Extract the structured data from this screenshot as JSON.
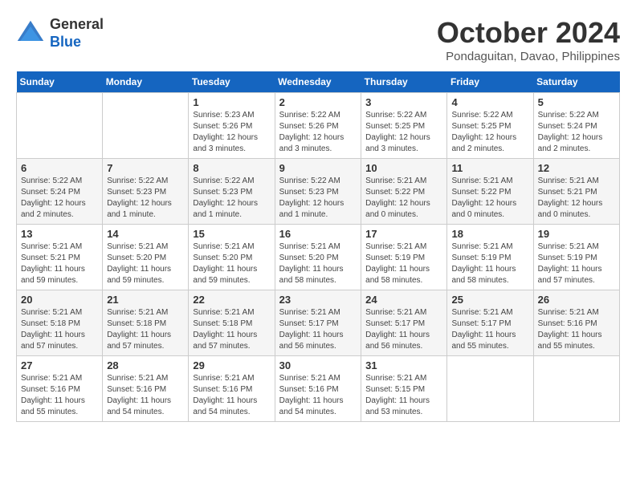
{
  "header": {
    "logo": {
      "general": "General",
      "blue": "Blue"
    },
    "title": "October 2024",
    "subtitle": "Pondaguitan, Davao, Philippines"
  },
  "weekdays": [
    "Sunday",
    "Monday",
    "Tuesday",
    "Wednesday",
    "Thursday",
    "Friday",
    "Saturday"
  ],
  "weeks": [
    [
      {
        "day": null
      },
      {
        "day": null
      },
      {
        "day": 1,
        "sunrise": "5:23 AM",
        "sunset": "5:26 PM",
        "daylight": "12 hours and 3 minutes."
      },
      {
        "day": 2,
        "sunrise": "5:22 AM",
        "sunset": "5:26 PM",
        "daylight": "12 hours and 3 minutes."
      },
      {
        "day": 3,
        "sunrise": "5:22 AM",
        "sunset": "5:25 PM",
        "daylight": "12 hours and 3 minutes."
      },
      {
        "day": 4,
        "sunrise": "5:22 AM",
        "sunset": "5:25 PM",
        "daylight": "12 hours and 2 minutes."
      },
      {
        "day": 5,
        "sunrise": "5:22 AM",
        "sunset": "5:24 PM",
        "daylight": "12 hours and 2 minutes."
      }
    ],
    [
      {
        "day": 6,
        "sunrise": "5:22 AM",
        "sunset": "5:24 PM",
        "daylight": "12 hours and 2 minutes."
      },
      {
        "day": 7,
        "sunrise": "5:22 AM",
        "sunset": "5:23 PM",
        "daylight": "12 hours and 1 minute."
      },
      {
        "day": 8,
        "sunrise": "5:22 AM",
        "sunset": "5:23 PM",
        "daylight": "12 hours and 1 minute."
      },
      {
        "day": 9,
        "sunrise": "5:22 AM",
        "sunset": "5:23 PM",
        "daylight": "12 hours and 1 minute."
      },
      {
        "day": 10,
        "sunrise": "5:21 AM",
        "sunset": "5:22 PM",
        "daylight": "12 hours and 0 minutes."
      },
      {
        "day": 11,
        "sunrise": "5:21 AM",
        "sunset": "5:22 PM",
        "daylight": "12 hours and 0 minutes."
      },
      {
        "day": 12,
        "sunrise": "5:21 AM",
        "sunset": "5:21 PM",
        "daylight": "12 hours and 0 minutes."
      }
    ],
    [
      {
        "day": 13,
        "sunrise": "5:21 AM",
        "sunset": "5:21 PM",
        "daylight": "11 hours and 59 minutes."
      },
      {
        "day": 14,
        "sunrise": "5:21 AM",
        "sunset": "5:20 PM",
        "daylight": "11 hours and 59 minutes."
      },
      {
        "day": 15,
        "sunrise": "5:21 AM",
        "sunset": "5:20 PM",
        "daylight": "11 hours and 59 minutes."
      },
      {
        "day": 16,
        "sunrise": "5:21 AM",
        "sunset": "5:20 PM",
        "daylight": "11 hours and 58 minutes."
      },
      {
        "day": 17,
        "sunrise": "5:21 AM",
        "sunset": "5:19 PM",
        "daylight": "11 hours and 58 minutes."
      },
      {
        "day": 18,
        "sunrise": "5:21 AM",
        "sunset": "5:19 PM",
        "daylight": "11 hours and 58 minutes."
      },
      {
        "day": 19,
        "sunrise": "5:21 AM",
        "sunset": "5:19 PM",
        "daylight": "11 hours and 57 minutes."
      }
    ],
    [
      {
        "day": 20,
        "sunrise": "5:21 AM",
        "sunset": "5:18 PM",
        "daylight": "11 hours and 57 minutes."
      },
      {
        "day": 21,
        "sunrise": "5:21 AM",
        "sunset": "5:18 PM",
        "daylight": "11 hours and 57 minutes."
      },
      {
        "day": 22,
        "sunrise": "5:21 AM",
        "sunset": "5:18 PM",
        "daylight": "11 hours and 57 minutes."
      },
      {
        "day": 23,
        "sunrise": "5:21 AM",
        "sunset": "5:17 PM",
        "daylight": "11 hours and 56 minutes."
      },
      {
        "day": 24,
        "sunrise": "5:21 AM",
        "sunset": "5:17 PM",
        "daylight": "11 hours and 56 minutes."
      },
      {
        "day": 25,
        "sunrise": "5:21 AM",
        "sunset": "5:17 PM",
        "daylight": "11 hours and 55 minutes."
      },
      {
        "day": 26,
        "sunrise": "5:21 AM",
        "sunset": "5:16 PM",
        "daylight": "11 hours and 55 minutes."
      }
    ],
    [
      {
        "day": 27,
        "sunrise": "5:21 AM",
        "sunset": "5:16 PM",
        "daylight": "11 hours and 55 minutes."
      },
      {
        "day": 28,
        "sunrise": "5:21 AM",
        "sunset": "5:16 PM",
        "daylight": "11 hours and 54 minutes."
      },
      {
        "day": 29,
        "sunrise": "5:21 AM",
        "sunset": "5:16 PM",
        "daylight": "11 hours and 54 minutes."
      },
      {
        "day": 30,
        "sunrise": "5:21 AM",
        "sunset": "5:16 PM",
        "daylight": "11 hours and 54 minutes."
      },
      {
        "day": 31,
        "sunrise": "5:21 AM",
        "sunset": "5:15 PM",
        "daylight": "11 hours and 53 minutes."
      },
      {
        "day": null
      },
      {
        "day": null
      }
    ]
  ]
}
